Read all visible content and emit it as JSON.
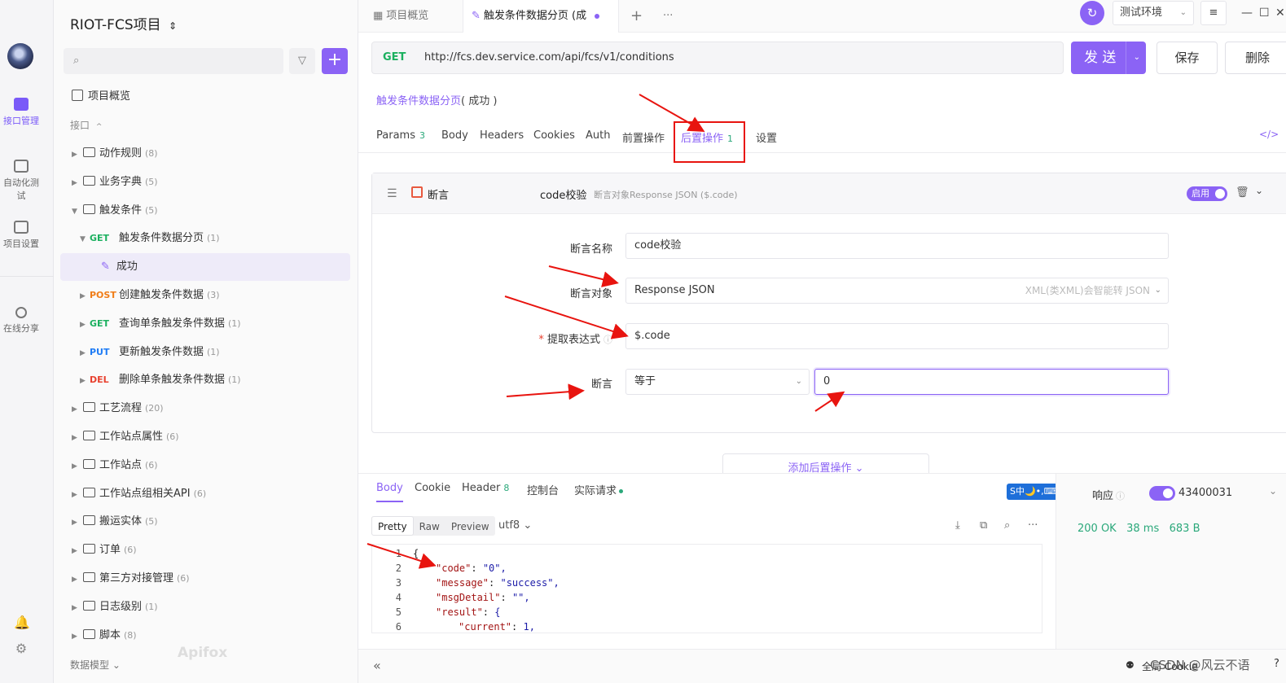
{
  "rail": {
    "items": [
      {
        "label": "接口管理",
        "icon": "api-icon",
        "active": true
      },
      {
        "label": "自动化测试",
        "icon": "automation-icon",
        "active": false
      },
      {
        "label": "项目设置",
        "icon": "settings-icon",
        "active": false
      },
      {
        "label": "在线分享",
        "icon": "share-icon",
        "active": false
      }
    ]
  },
  "sidebar": {
    "project_name": "RIOT-FCS项目",
    "overview": "项目概览",
    "section": "接口",
    "tree": [
      {
        "type": "folder",
        "name": "动作规则",
        "count": "(8)"
      },
      {
        "type": "folder",
        "name": "业务字典",
        "count": "(5)"
      },
      {
        "type": "folder-open",
        "name": "触发条件",
        "count": "(5)"
      },
      {
        "type": "api",
        "method": "GET",
        "name": "触发条件数据分页",
        "count": "(1)"
      },
      {
        "type": "case",
        "name": "成功"
      },
      {
        "type": "api",
        "method": "POST",
        "name": "创建触发条件数据",
        "count": "(3)"
      },
      {
        "type": "api",
        "method": "GET",
        "name": "查询单条触发条件数据",
        "count": "(1)"
      },
      {
        "type": "api",
        "method": "PUT",
        "name": "更新触发条件数据",
        "count": "(1)"
      },
      {
        "type": "api",
        "method": "DEL",
        "name": "删除单条触发条件数据",
        "count": "(1)"
      },
      {
        "type": "folder",
        "name": "工艺流程",
        "count": "(20)"
      },
      {
        "type": "folder",
        "name": "工作站点属性",
        "count": "(6)"
      },
      {
        "type": "folder",
        "name": "工作站点",
        "count": "(6)"
      },
      {
        "type": "folder",
        "name": "工作站点组相关API",
        "count": "(6)"
      },
      {
        "type": "folder",
        "name": "搬运实体",
        "count": "(5)"
      },
      {
        "type": "folder",
        "name": "订单",
        "count": "(6)"
      },
      {
        "type": "folder",
        "name": "第三方对接管理",
        "count": "(6)"
      },
      {
        "type": "folder",
        "name": "日志级别",
        "count": "(1)"
      },
      {
        "type": "folder",
        "name": "脚本",
        "count": "(8)"
      }
    ],
    "bottom_label": "数据模型",
    "watermark": "Apifox"
  },
  "tabs": {
    "overview": "项目概览",
    "active": "触发条件数据分页 (成",
    "env": "测试环境"
  },
  "request": {
    "method": "GET",
    "url": "http://fcs.dev.service.com/api/fcs/v1/conditions",
    "send": "发 送",
    "save": "保存",
    "delete": "删除",
    "case_name": "触发条件数据分页",
    "case_status": "( 成功 )",
    "tabs": [
      {
        "label": "Params",
        "count": "3"
      },
      {
        "label": "Body",
        "count": ""
      },
      {
        "label": "Headers",
        "count": ""
      },
      {
        "label": "Cookies",
        "count": ""
      },
      {
        "label": "Auth",
        "count": ""
      },
      {
        "label": "前置操作",
        "count": ""
      },
      {
        "label": "后置操作",
        "count": "1"
      },
      {
        "label": "设置",
        "count": ""
      }
    ]
  },
  "assertion": {
    "type": "断言",
    "title": "code校验",
    "desc": "断言对象Response JSON ($.code)",
    "enabled_label": "启用",
    "fields": {
      "name_label": "断言名称",
      "name_value": "code校验",
      "target_label": "断言对象",
      "target_value": "Response JSON",
      "target_hint": "XML(类XML)会智能转 JSON",
      "expr_label": "提取表达式",
      "expr_value": "$.code",
      "assert_label": "断言",
      "op_value": "等于",
      "expected_value": "0"
    },
    "add_post": "添加后置操作"
  },
  "response": {
    "tabs": [
      {
        "label": "Body",
        "count": ""
      },
      {
        "label": "Cookie",
        "count": ""
      },
      {
        "label": "Header",
        "count": "8"
      },
      {
        "label": "控制台",
        "count": ""
      },
      {
        "label": "实际请求",
        "count": ""
      }
    ],
    "view_modes": [
      "Pretty",
      "Raw",
      "Preview"
    ],
    "encoding": "utf8",
    "code_lines": [
      {
        "n": "1",
        "text": "{"
      },
      {
        "n": "2",
        "key": "\"code\"",
        "val": "\"0\","
      },
      {
        "n": "3",
        "key": "\"message\"",
        "val": "\"success\","
      },
      {
        "n": "4",
        "key": "\"msgDetail\"",
        "val": "\"\","
      },
      {
        "n": "5",
        "key": "\"result\"",
        "val": "{"
      },
      {
        "n": "6",
        "key": "\"current\"",
        "val": "1,"
      }
    ],
    "right_label": "响应",
    "right_id": "43400031",
    "status": "200 OK",
    "time": "38 ms",
    "size": "683 B",
    "ime": "S中🌙•,⌨🔧"
  },
  "footer": {
    "collapse": "«",
    "global_cookie": "全局 Cookie",
    "watermark": "CSDN @风云不语"
  }
}
